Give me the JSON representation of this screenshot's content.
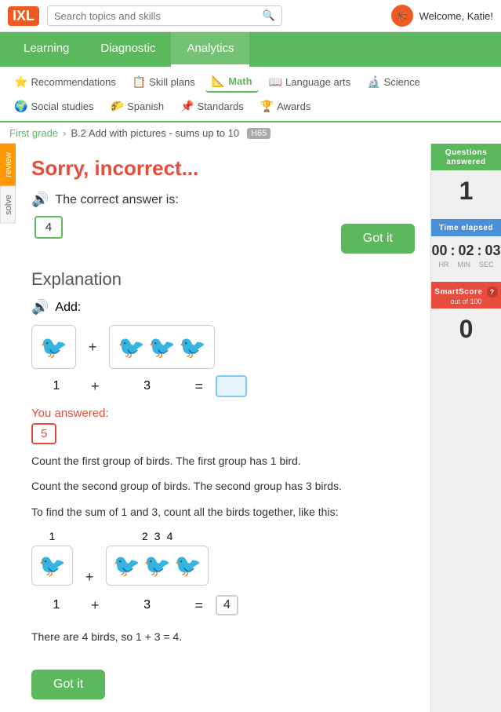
{
  "topBar": {
    "logo": "IXL",
    "searchPlaceholder": "Search topics and skills",
    "welcomeText": "Welcome, Katie!"
  },
  "navTabs": [
    {
      "id": "learning",
      "label": "Learning"
    },
    {
      "id": "diagnostic",
      "label": "Diagnostic"
    },
    {
      "id": "analytics",
      "label": "Analytics"
    }
  ],
  "subNav": [
    {
      "id": "recommendations",
      "label": "Recommendations",
      "icon": "⭐"
    },
    {
      "id": "skill-plans",
      "label": "Skill plans",
      "icon": "📋"
    },
    {
      "id": "math",
      "label": "Math",
      "icon": "📐",
      "active": true
    },
    {
      "id": "language-arts",
      "label": "Language arts",
      "icon": "📖"
    },
    {
      "id": "science",
      "label": "Science",
      "icon": "🔬"
    },
    {
      "id": "social-studies",
      "label": "Social studies",
      "icon": "🌍"
    },
    {
      "id": "spanish",
      "label": "Spanish",
      "icon": "🌮"
    },
    {
      "id": "standards",
      "label": "Standards",
      "icon": "📌"
    },
    {
      "id": "awards",
      "label": "Awards",
      "icon": "🏆"
    }
  ],
  "breadcrumb": {
    "grade": "First grade",
    "skill": "B.2 Add with pictures - sums up to 10",
    "badge": "H65"
  },
  "question": {
    "incorrectTitle": "Sorry, incorrect...",
    "correctAnswerLabel": "The correct answer is:",
    "correctAnswer": "4",
    "gotItLabel": "Got it"
  },
  "sidebar": {
    "questionsAnsweredLabel": "Questions answered",
    "questionsAnsweredValue": "1",
    "timeElapsedLabel": "Time elapsed",
    "timeHr": "00",
    "timeMin": "02",
    "timeSec": "03",
    "timeHrLabel": "HR",
    "timeMinLabel": "MIN",
    "timeSecLabel": "SEC",
    "smartScoreLabel": "SmartScore",
    "smartScoreSubLabel": "out of 100",
    "smartScoreValue": "0"
  },
  "explanation": {
    "title": "Explanation",
    "addLabel": "Add:",
    "youAnsweredLabel": "You answered:",
    "youAnsweredValue": "5",
    "explanationLines": [
      "Count the first group of birds. The first group has 1 bird.",
      "Count the second group of birds. The second group has 3 birds.",
      "To find the sum of 1 and 3, count all the birds together, like this:"
    ],
    "finalLine": "There are 4 birds, so 1 + 3 = 4.",
    "sum1": "1",
    "op1": "+",
    "sum2": "3",
    "eq1": "=",
    "answerDisplay": "4",
    "bird": "🐦",
    "gotItLabel": "Got it"
  }
}
